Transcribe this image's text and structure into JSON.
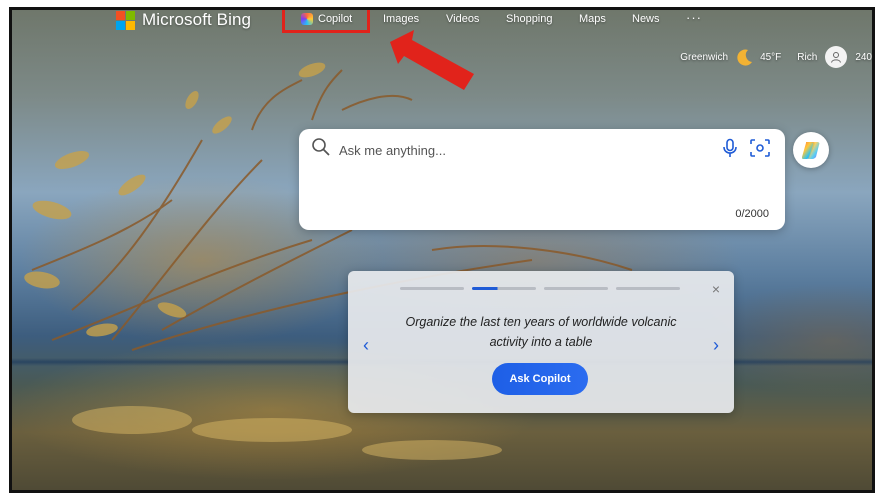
{
  "header": {
    "brand": "Microsoft Bing",
    "nav": [
      "Copilot",
      "Images",
      "Videos",
      "Shopping",
      "Maps",
      "News"
    ],
    "more": "···",
    "location": "Greenwich",
    "temperature": "45°F",
    "user_name": "Rich",
    "rewards_points": "240"
  },
  "search": {
    "placeholder": "Ask me anything...",
    "char_count": "0/2000"
  },
  "prompt_card": {
    "suggestion": "Organize the last ten years of worldwide volcanic activity into a table",
    "button_label": "Ask Copilot",
    "close": "×",
    "prev": "‹",
    "next": "›",
    "active_page": 2,
    "total_pages": 4
  },
  "colors": {
    "accent": "#1f5bd6",
    "highlight": "#e1231b"
  },
  "icons": [
    "microsoft-logo-icon",
    "copilot-icon",
    "moon-icon",
    "user-icon",
    "search-icon",
    "microphone-icon",
    "visual-search-icon",
    "copilot-orb-icon",
    "red-arrow-icon"
  ]
}
